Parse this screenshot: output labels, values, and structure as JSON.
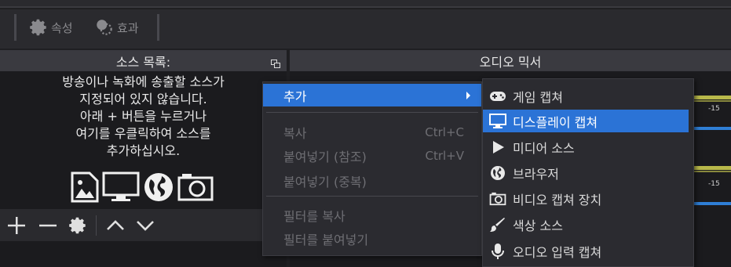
{
  "toolbar": {
    "properties_label": "속성",
    "filters_label": "효과"
  },
  "sources_panel": {
    "title": "소스 목록:",
    "empty_hint": "방송이나 녹화에 송출할 소스가\n지정되어 있지 않습니다.\n아래 + 버튼을 누르거나\n여기를 우클릭하여 소스를\n추가하십시오."
  },
  "audio_mixer": {
    "title": "오디오 믹서",
    "tracks": [
      {
        "tick_label": "-15"
      },
      {
        "tick_label": "-15"
      }
    ]
  },
  "context_menu": {
    "add_label": "추가",
    "copy_label": "복사",
    "copy_shortcut": "Ctrl+C",
    "paste_ref_label": "붙여넣기 (참조)",
    "paste_ref_shortcut": "Ctrl+V",
    "paste_dup_label": "붙여넣기 (중복)",
    "copy_filters_label": "필터를 복사",
    "paste_filters_label": "필터를 붙여넣기"
  },
  "add_submenu": {
    "items": [
      {
        "label": "게임 캡쳐",
        "icon": "gamepad-icon"
      },
      {
        "label": "디스플레이 캡쳐",
        "icon": "monitor-icon"
      },
      {
        "label": "미디어 소스",
        "icon": "play-icon"
      },
      {
        "label": "브라우저",
        "icon": "globe-icon"
      },
      {
        "label": "비디오 캡쳐 장치",
        "icon": "camera-icon"
      },
      {
        "label": "색상 소스",
        "icon": "brush-icon"
      },
      {
        "label": "오디오 입력 캡쳐",
        "icon": "microphone-icon"
      }
    ],
    "highlighted_index": 1
  },
  "colors": {
    "highlight": "#2b73d6",
    "meter_yellow": "#b8b84a",
    "meter_blue": "#2f7fd6"
  }
}
